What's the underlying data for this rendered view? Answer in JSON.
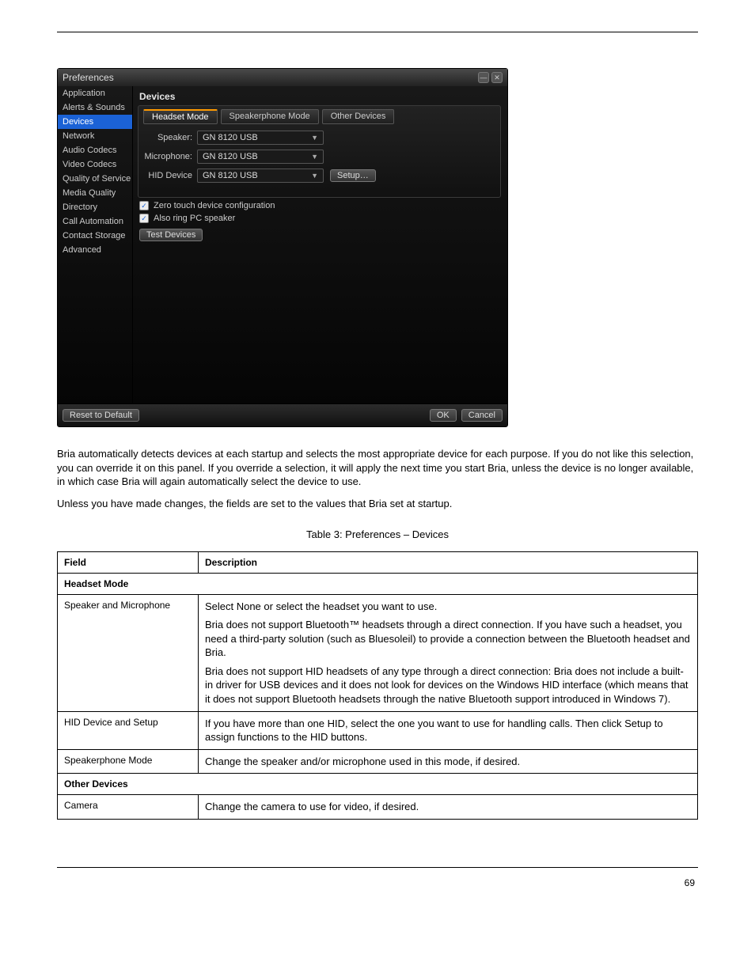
{
  "dialog": {
    "title": "Preferences",
    "min_tooltip": "Minimize",
    "close_tooltip": "Close",
    "sidebar": {
      "items": [
        {
          "label": "Application"
        },
        {
          "label": "Alerts & Sounds"
        },
        {
          "label": "Devices",
          "active": true
        },
        {
          "label": "Network"
        },
        {
          "label": "Audio Codecs"
        },
        {
          "label": "Video Codecs"
        },
        {
          "label": "Quality of Service"
        },
        {
          "label": "Media Quality"
        },
        {
          "label": "Directory"
        },
        {
          "label": "Call Automation"
        },
        {
          "label": "Contact Storage"
        },
        {
          "label": "Advanced"
        }
      ]
    },
    "section_title": "Devices",
    "tabs": [
      {
        "label": "Headset Mode",
        "active": true
      },
      {
        "label": "Speakerphone Mode"
      },
      {
        "label": "Other Devices"
      }
    ],
    "rows": {
      "speaker": {
        "label": "Speaker:",
        "value": "GN 8120 USB"
      },
      "microphone": {
        "label": "Microphone:",
        "value": "GN 8120 USB"
      },
      "hid": {
        "label": "HID Device",
        "value": "GN 8120 USB",
        "setup": "Setup…"
      }
    },
    "checks": {
      "zero": {
        "label": "Zero touch device configuration",
        "checked": true
      },
      "ring": {
        "label": "Also ring PC speaker",
        "checked": true
      }
    },
    "test_btn": "Test Devices",
    "footer": {
      "reset": "Reset to Default",
      "ok": "OK",
      "cancel": "Cancel"
    }
  },
  "body": {
    "p1": "Bria automatically detects devices at each startup and selects the most appropriate device for each purpose. If you do not like this selection, you can override it on this panel. If you override a selection, it will apply the next time you start Bria, unless the device is no longer available, in which case Bria will again automatically select the device to use.",
    "p2": "Unless you have made changes, the fields are set to the values that Bria set at startup.",
    "table_intro": "Table 3: Preferences – Devices",
    "table": {
      "header": {
        "field": "Field",
        "description": "Description"
      },
      "rows": [
        {
          "section": "Headset Mode"
        },
        {
          "field": "Speaker and Microphone",
          "description": [
            "Select None or select the headset you want to use.",
            "Bria does not support Bluetooth™ headsets through a direct connection. If you have such a headset, you need a third-party solution (such as Bluesoleil) to provide a connection between the Bluetooth headset and Bria.",
            "Bria does not support HID headsets of any type through a direct connection: Bria does not include a built-in driver for USB devices and it does not look for devices on the Windows HID interface (which means that it does not support Bluetooth headsets through the native Bluetooth support introduced in Windows 7)."
          ]
        },
        {
          "field": "HID Device and Setup",
          "description": [
            "If you have more than one HID, select the one you want to use for handling calls. Then click Setup to assign functions to the HID buttons."
          ]
        },
        {
          "field": "Speakerphone Mode",
          "description": [
            "Change the speaker and/or microphone used in this mode, if desired."
          ]
        },
        {
          "section": "Other Devices"
        },
        {
          "field": "Camera",
          "description": [
            "Change the camera to use for video, if desired."
          ]
        }
      ]
    }
  },
  "footer": {
    "left": "",
    "right": "69"
  }
}
